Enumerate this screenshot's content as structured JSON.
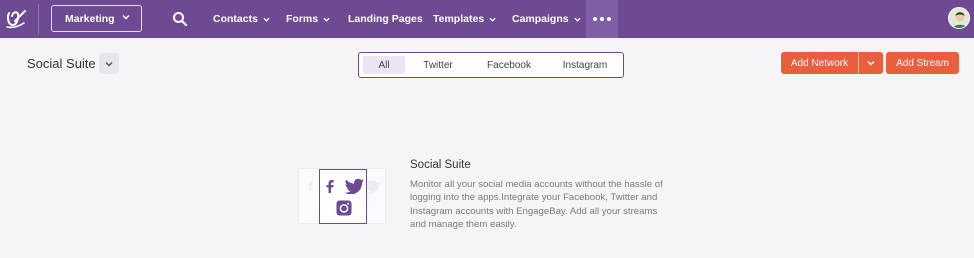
{
  "nav": {
    "app_selector": "Marketing",
    "items": [
      {
        "label": "Contacts",
        "has_dropdown": true
      },
      {
        "label": "Forms",
        "has_dropdown": true
      },
      {
        "label": "Landing Pages",
        "has_dropdown": false
      },
      {
        "label": "Templates",
        "has_dropdown": true
      },
      {
        "label": "Campaigns",
        "has_dropdown": true
      }
    ],
    "icons": [
      "logo-icon",
      "search-icon",
      "more-icon",
      "avatar"
    ]
  },
  "page": {
    "title": "Social Suite"
  },
  "filters": {
    "tabs": [
      "All",
      "Twitter",
      "Facebook",
      "Instagram"
    ],
    "active": "All"
  },
  "actions": {
    "add_network": "Add Network",
    "add_stream": "Add Stream"
  },
  "empty_state": {
    "title": "Social Suite",
    "description": "Monitor all your social media accounts without the hassle of logging into the apps.Integrate your Facebook, Twitter and Instagram accounts with EngageBay. Add all your streams and manage them easily.",
    "icons": [
      "facebook-icon",
      "twitter-icon",
      "instagram-icon"
    ]
  },
  "colors": {
    "nav_bg": "#6d4a92",
    "accent_orange": "#ea5e3d",
    "page_bg": "#f5f5f8"
  }
}
